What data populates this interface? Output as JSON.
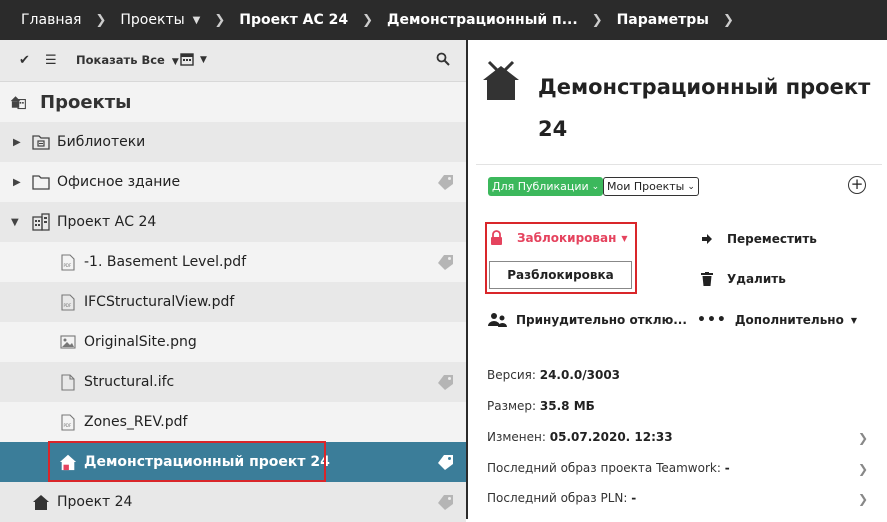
{
  "breadcrumb": {
    "items": [
      "Главная",
      "Проекты",
      "Проект АС 24",
      "Демонстрационный п...",
      "Параметры"
    ]
  },
  "toolbar": {
    "show_all_label": "Показать Все"
  },
  "tree": {
    "root_label": "Проекты",
    "items": [
      {
        "label": "Библиотеки"
      },
      {
        "label": "Офисное здание"
      },
      {
        "label": "Проект АС 24"
      },
      {
        "label": "-1. Basement Level.pdf"
      },
      {
        "label": "IFCStructuralView.pdf"
      },
      {
        "label": "OriginalSite.png"
      },
      {
        "label": "Structural.ifc"
      },
      {
        "label": "Zones_REV.pdf"
      },
      {
        "label": "Демонстрационный проект 24"
      },
      {
        "label": "Проект 24"
      }
    ]
  },
  "detail": {
    "title": "Демонстрационный проект 24",
    "publish_label": "Для Публикации",
    "projects_label": "Мои Проекты",
    "locked_label": "Заблокирован",
    "unlock_label": "Разблокировка",
    "move_label": "Переместить",
    "delete_label": "Удалить",
    "force_label": "Принудительно отклю...",
    "more_label": "Дополнительно",
    "info": [
      {
        "label": "Версия:",
        "value": "24.0.0/3003"
      },
      {
        "label": "Размер:",
        "value": "35.8 МБ"
      },
      {
        "label": "Изменен:",
        "value": "05.07.2020. 12:33"
      },
      {
        "label": "Последний образ проекта Teamwork:",
        "value": "-"
      },
      {
        "label": "Последний образ PLN:",
        "value": "-"
      }
    ]
  },
  "colors": {
    "selected_row": "#3b7d99",
    "locked": "#e5435e",
    "green": "#3cb85c",
    "highlight": "#d9262a"
  }
}
